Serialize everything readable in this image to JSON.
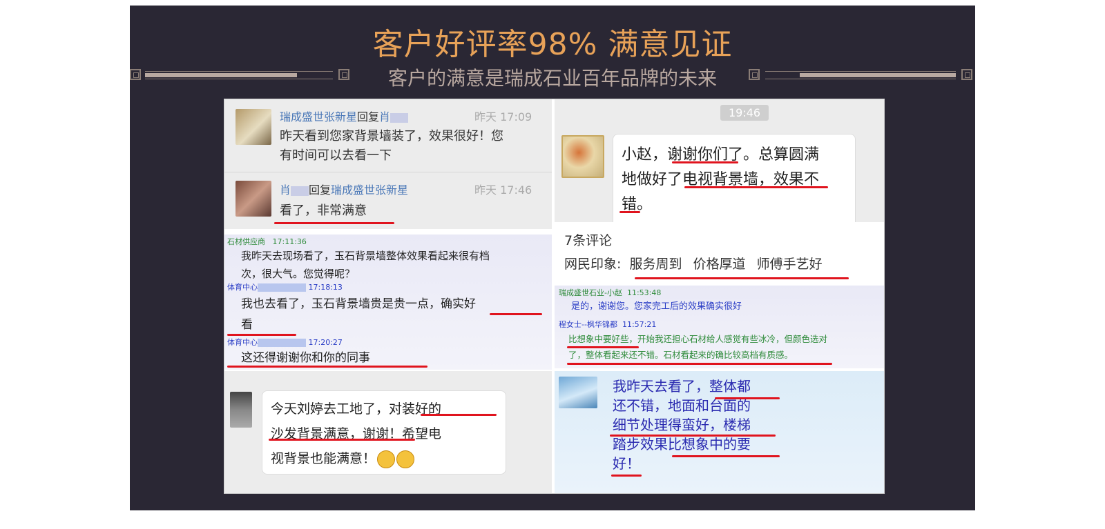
{
  "header": {
    "title": "客户好评率98%  满意见证",
    "subtitle": "客户的满意是瑞成石业百年品牌的未来"
  },
  "colors": {
    "banner_bg": "#2a2734",
    "title": "#e8a258",
    "subtitle": "#b9a8a0",
    "underline": "#e0141e"
  },
  "panel1": {
    "post1": {
      "name": "瑞成盛世张新星",
      "reply": "回复",
      "to": "肖",
      "time": "昨天 17:09",
      "text1": "昨天看到您家背景墙装了，效果很好！您",
      "text2": "有时间可以去看一下"
    },
    "post2": {
      "name": "肖",
      "reply": "回复",
      "to": "瑞成盛世张新星",
      "time": "昨天 17:46",
      "text": "看了，非常满意"
    }
  },
  "panel2": {
    "timestamp": "19:46",
    "line1": "小赵，谢谢你们了。总算圆满",
    "line2": "地做好了电视背景墙，效果不",
    "line3": "错。"
  },
  "panel3": {
    "m1": {
      "name": "石材供应商",
      "time": "17:11:36",
      "text1": "我昨天去现场看了，玉石背景墙整体效果看起来很有档",
      "text2": "次，很大气。您觉得呢？"
    },
    "m2": {
      "name": "体育中心",
      "time": "17:18:13",
      "text1": "我也去看了，玉石背景墙贵是贵一点，确实好",
      "text2": "看"
    },
    "m3": {
      "name": "体育中心",
      "time": "17:20:27",
      "text": "这还得谢谢你和你的同事"
    }
  },
  "panel4": {
    "count": "7条评论",
    "impression_label": "网民印象:",
    "tags": [
      "服务周到",
      "价格厚道",
      "师傅手艺好"
    ]
  },
  "panel5": {
    "m1": {
      "name": "瑞成盛世石业-小赵",
      "time": "11:53:48",
      "text": "是的，谢谢您。您家完工后的效果确实很好"
    },
    "m2": {
      "name": "程女士--枫华锦都",
      "time": "11:57:21",
      "text1": "比想象中要好些，开始我还担心石材给人感觉有些冰冷，但颜色选对",
      "text2": "了，整体看起来还不错。石材看起来的确比较高档有质感。"
    }
  },
  "panel6": {
    "line1": "今天刘婷去工地了，对装好的",
    "line2": "沙发背景满意，谢谢！希望电",
    "line3": "视背景也能满意！"
  },
  "panel7": {
    "line1": "我昨天去看了，整体都",
    "line2": "还不错，地面和台面的",
    "line3": "细节处理得蛮好，楼梯",
    "line4": "踏步效果比想象中的要",
    "line5": "好！"
  }
}
